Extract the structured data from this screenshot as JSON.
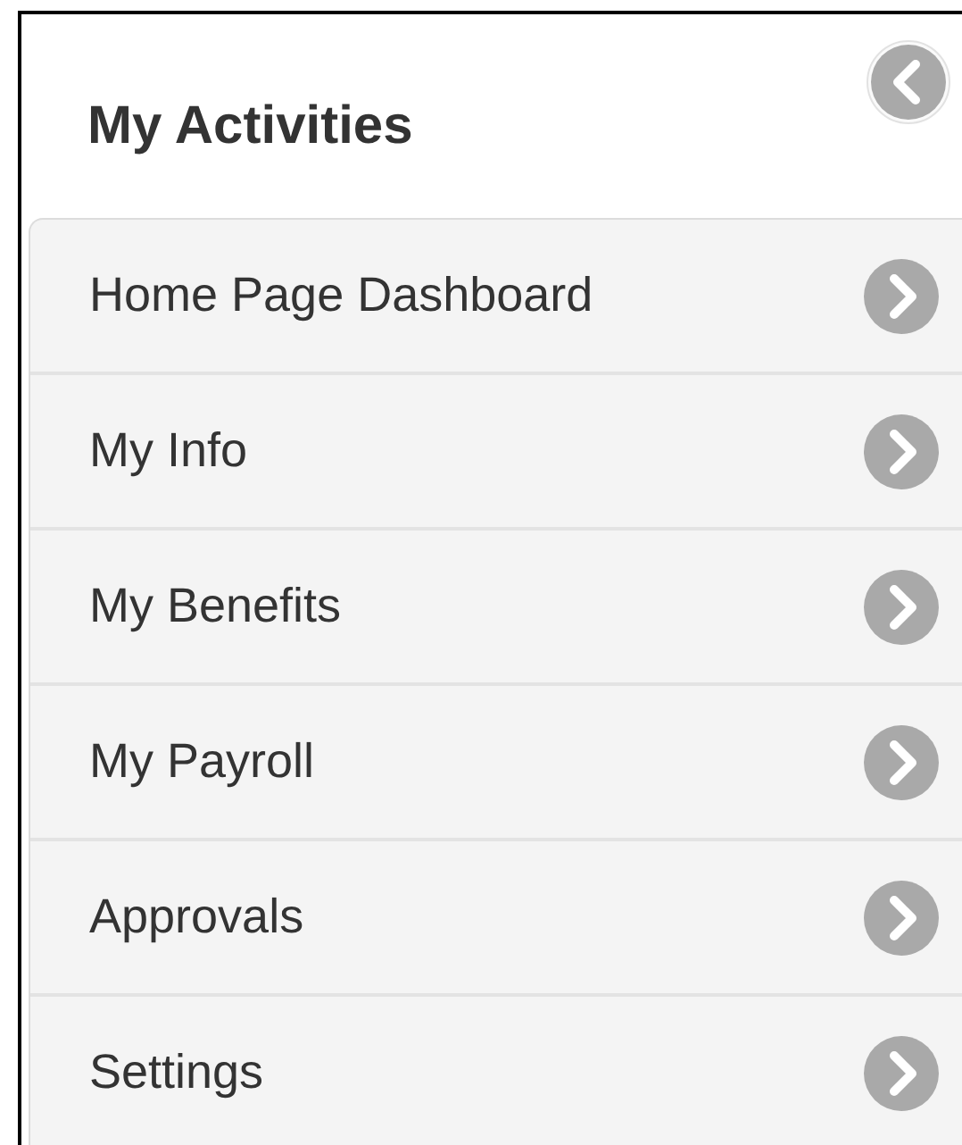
{
  "panel": {
    "title": "My Activities"
  },
  "menu_items": [
    {
      "label": "Home Page Dashboard"
    },
    {
      "label": "My Info"
    },
    {
      "label": "My Benefits"
    },
    {
      "label": "My Payroll"
    },
    {
      "label": "Approvals"
    },
    {
      "label": "Settings"
    }
  ]
}
